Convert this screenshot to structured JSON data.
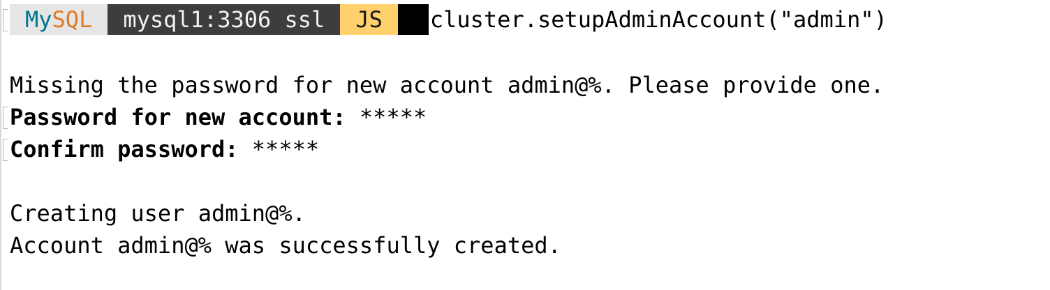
{
  "prompt": {
    "product_my": "My",
    "product_sql": "SQL",
    "host": "mysql1:3306 ssl",
    "mode": "JS",
    "command": "cluster.setupAdminAccount(\"admin\")"
  },
  "output": {
    "missing_password": "Missing the password for new account admin@%. Please provide one.",
    "password_label": "Password for new account:",
    "password_value": "*****",
    "confirm_label": "Confirm password:",
    "confirm_value": "*****",
    "creating_user": "Creating user admin@%.",
    "account_created": "Account admin@% was successfully created."
  },
  "colors": {
    "mysql_my": "#00758f",
    "mysql_sql": "#e17a26",
    "host_bg": "#3d3d3d",
    "mode_bg": "#ffd06b"
  }
}
